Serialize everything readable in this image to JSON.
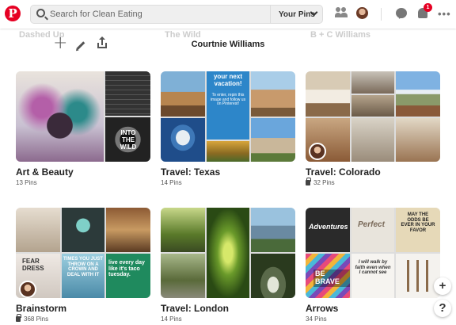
{
  "header": {
    "logo": "P",
    "search_placeholder": "Search for Clean Eating",
    "your_pins": "Your Pins",
    "notification_count": "1",
    "more": "•••"
  },
  "profile": {
    "name": "Courtnie Williams",
    "ghost_titles": [
      "Dashed Up",
      "The Wild",
      "B + C Williams"
    ]
  },
  "boards": [
    {
      "title": "Art & Beauty",
      "count": "13 Pins",
      "secret": false
    },
    {
      "title": "Travel: Texas",
      "count": "14 Pins",
      "secret": false
    },
    {
      "title": "Travel: Colorado",
      "count": "32 Pins",
      "secret": true
    },
    {
      "title": "Brainstorm",
      "count": "368 Pins",
      "secret": true
    },
    {
      "title": "Travel: London",
      "count": "14 Pins",
      "secret": false
    },
    {
      "title": "Arrows",
      "count": "34 Pins",
      "secret": false
    }
  ],
  "cover_text": {
    "art_bw": "INTO THE WILD",
    "texas_vacation": "your next vacation!",
    "texas_enter": "To enter, repin this image and follow us on Pinterest!",
    "brain_fear": "FEAR DRESS",
    "brain_times": "TIMES YOU JUST THROW ON A CROWN AND DEAL WITH IT",
    "brain_taco": "live every day like it's taco tuesday.",
    "arrows_adv": "Adventures",
    "arrows_perfect": "Perfect",
    "arrows_walk": "I will walk by faith even when I cannot see",
    "arrows_brave": "BE BRAVE",
    "arrows_odds": "MAY THE ODDS BE EVER IN YOUR FAVOR"
  },
  "fabs": {
    "add": "+",
    "help": "?"
  }
}
